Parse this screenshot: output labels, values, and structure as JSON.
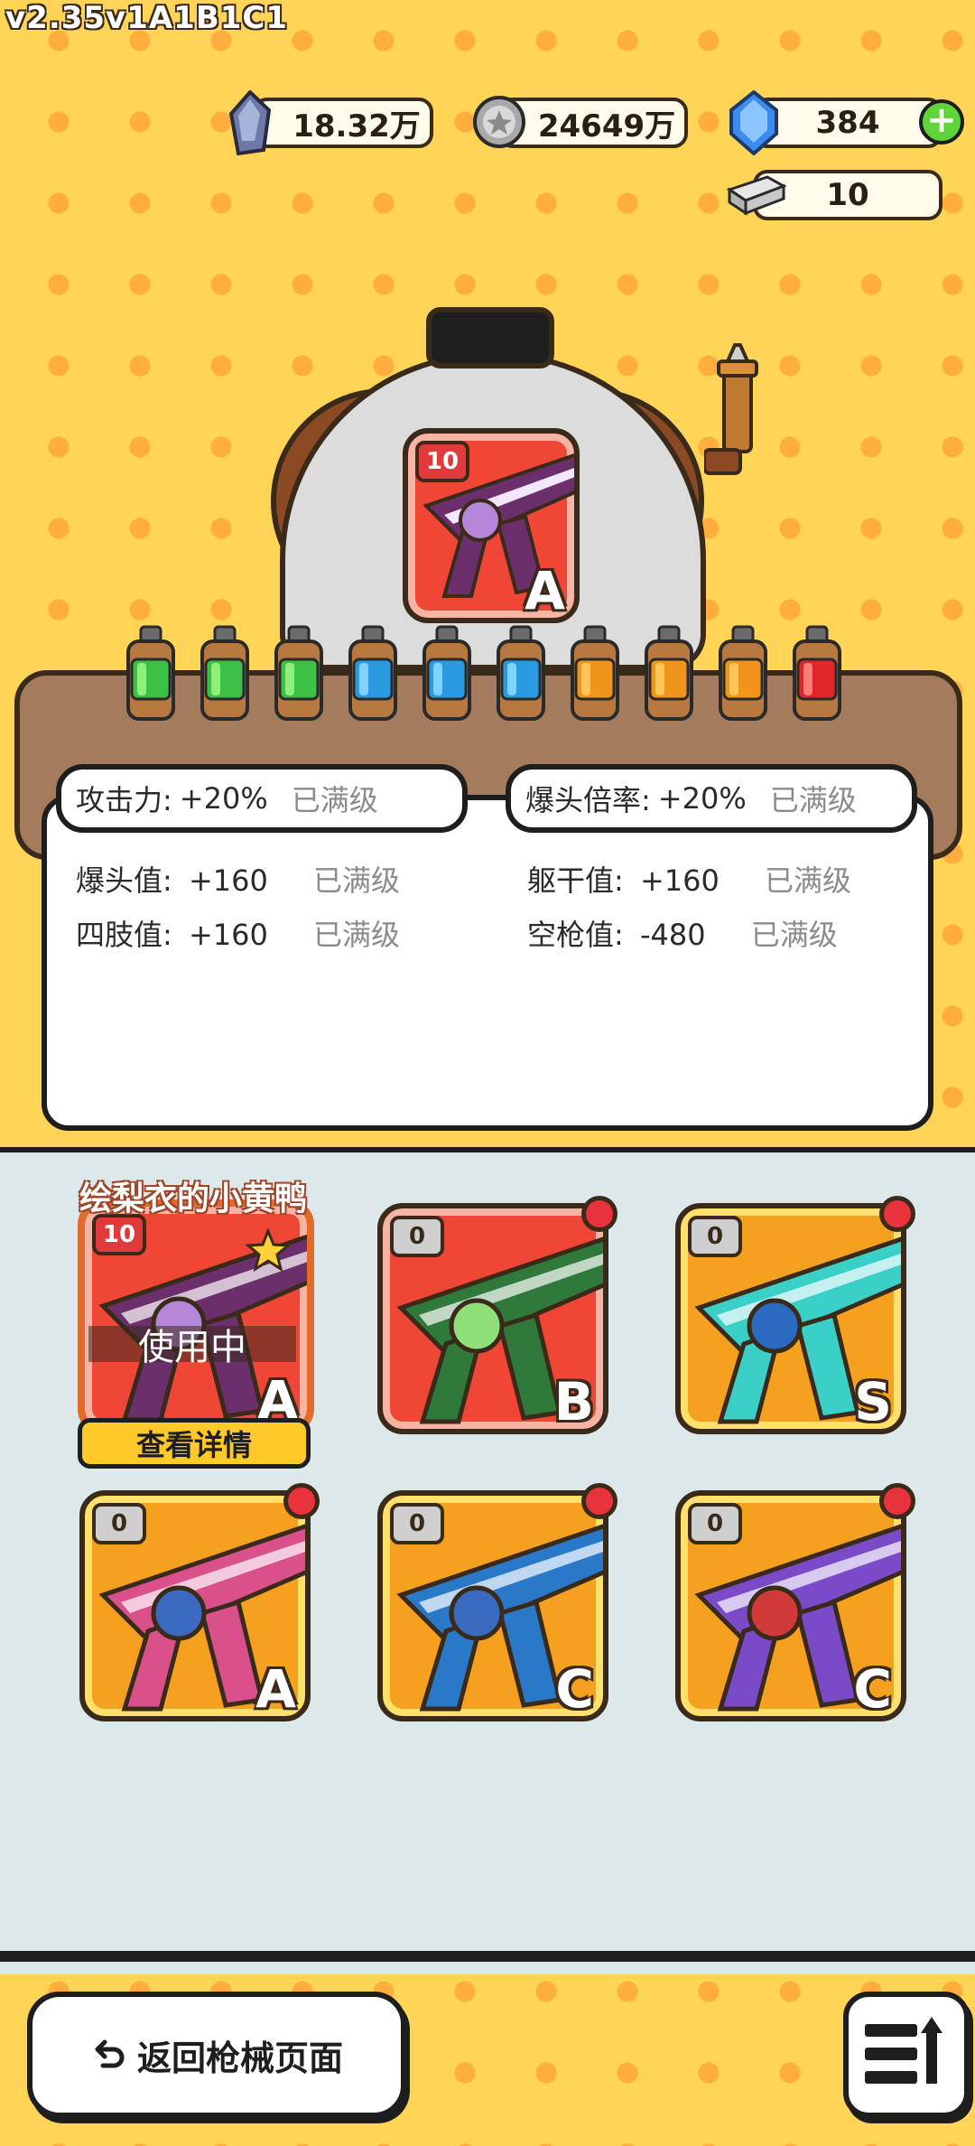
{
  "version": "v2.35v1A1B1C1",
  "currencies": {
    "crystal_ore": "18.32万",
    "coin": "24649万",
    "gem": "384",
    "silver_bar": "10"
  },
  "machine": {
    "card_level": "10",
    "card_grade": "A",
    "bottles": [
      "green",
      "green",
      "green",
      "blue",
      "blue",
      "blue",
      "orange",
      "orange",
      "orange",
      "red"
    ]
  },
  "stats": {
    "attack": {
      "label": "攻击力:",
      "value": "+20%",
      "status": "已满级"
    },
    "headshot_mult": {
      "label": "爆头倍率:",
      "value": "+20%",
      "status": "已满级"
    },
    "headshot_val": {
      "label": "爆头值:",
      "value": "+160",
      "status": "已满级"
    },
    "torso_val": {
      "label": "躯干值:",
      "value": "+160",
      "status": "已满级"
    },
    "limb_val": {
      "label": "四肢值:",
      "value": "+160",
      "status": "已满级"
    },
    "empty_val": {
      "label": "空枪值:",
      "value": "-480",
      "status": "已满级"
    }
  },
  "skins": [
    {
      "name": "绘梨衣的小黄鸭",
      "level": "10",
      "grade": "A",
      "in_use": "使用中",
      "detail": "查看详情"
    },
    {
      "level": "0",
      "grade": "B"
    },
    {
      "level": "0",
      "grade": "S"
    },
    {
      "level": "0",
      "grade": "A"
    },
    {
      "level": "0",
      "grade": "C"
    },
    {
      "level": "0",
      "grade": "C"
    }
  ],
  "nav": {
    "back_label": "返回枪械页面"
  },
  "colors": {
    "background": "#ffd457",
    "dots": "#ffad3d",
    "card_red": "#f04635",
    "card_orange": "#f5a01f",
    "badge_red": "#e8323c"
  }
}
